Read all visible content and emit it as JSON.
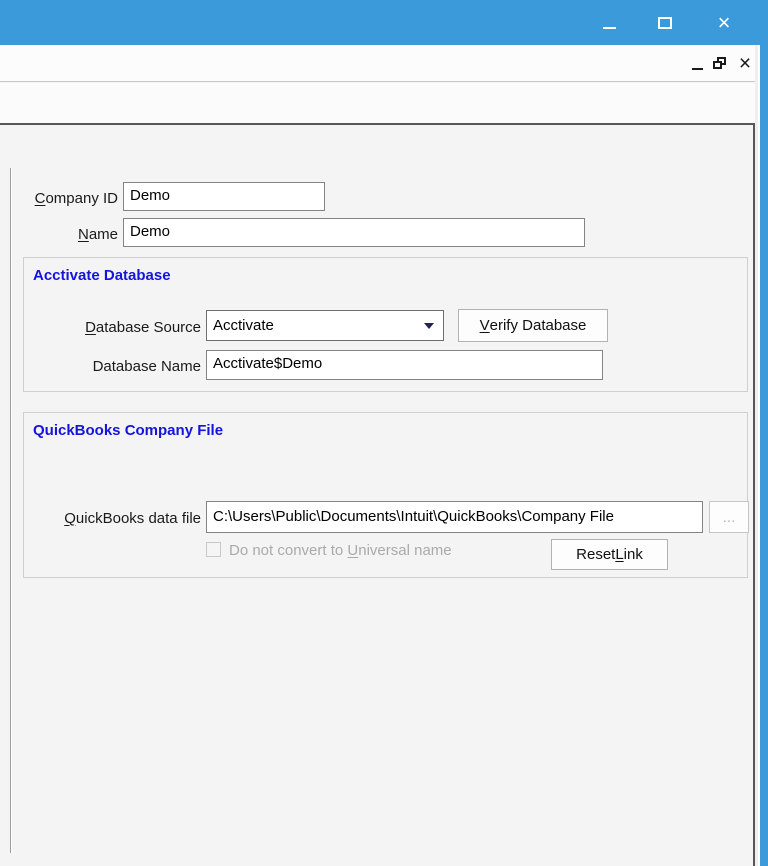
{
  "colors": {
    "titlebar_blue": "#3b9ad9",
    "heading_blue": "#1414dd",
    "disabled_text": "#aaaaaa"
  },
  "window": {
    "main_controls": {
      "minimize": "minimize",
      "maximize": "maximize",
      "close_glyph": "×"
    },
    "mdi_controls": {
      "minimize": "minimize",
      "restore": "restore",
      "close_glyph": "×"
    }
  },
  "form": {
    "company_id": {
      "label": "Company ID",
      "mnemonic": "C",
      "value": "Demo"
    },
    "company_name": {
      "label": "Name",
      "mnemonic": "N",
      "value": "Demo"
    }
  },
  "acctivate_group": {
    "title": "Acctivate Database",
    "database_source": {
      "label": "Database Source",
      "mnemonic": "D",
      "value": "Acctivate"
    },
    "verify_button": {
      "label": "Verify Database",
      "mnemonic": "V"
    },
    "database_name": {
      "label": "Database Name",
      "value": "Acctivate$Demo"
    }
  },
  "quickbooks_group": {
    "title": "QuickBooks Company File",
    "data_file": {
      "label": "QuickBooks data file",
      "mnemonic": "Q",
      "value": "C:\\Users\\Public\\Documents\\Intuit\\QuickBooks\\Company File"
    },
    "browse_button": {
      "label": "..."
    },
    "universal_checkbox": {
      "label": "Do not convert to Universal name",
      "mnemonic": "U",
      "checked": false
    },
    "reset_button": {
      "label": "Reset Link",
      "mnemonic": "L"
    }
  }
}
